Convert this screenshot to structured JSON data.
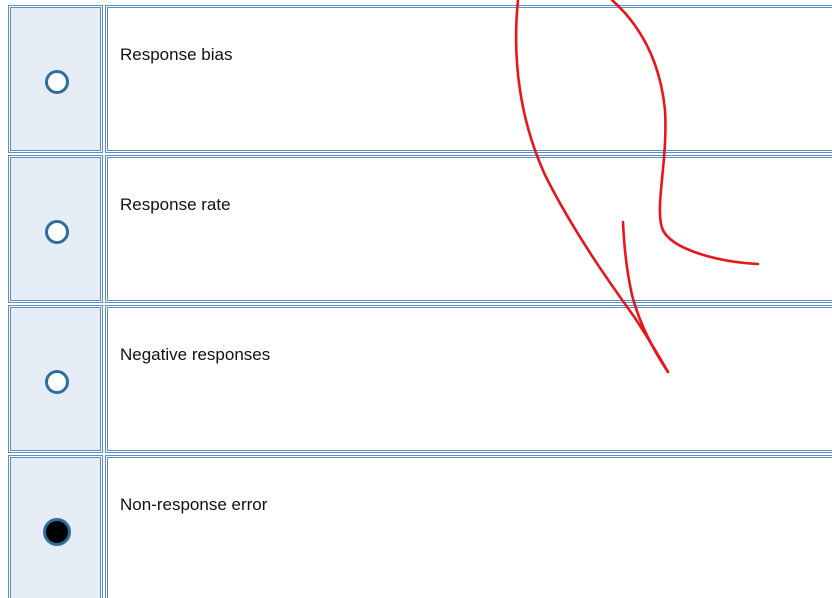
{
  "question": {
    "options": [
      {
        "label": "Response bias",
        "selected": false
      },
      {
        "label": "Response rate",
        "selected": false
      },
      {
        "label": "Negative responses",
        "selected": false
      },
      {
        "label": "Non-response error",
        "selected": true
      }
    ]
  },
  "colors": {
    "cell_border": "#5b8fc3",
    "radio_cell_bg": "#e6ecf6",
    "radio_ring": "#2e6e9e",
    "annotation_stroke": "#e8161b"
  },
  "icons": {
    "annotation": "red-freehand-arrow"
  }
}
